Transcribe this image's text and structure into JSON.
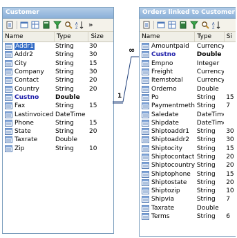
{
  "customer": {
    "title": "Customer",
    "columns": [
      "Name",
      "Type",
      "Size"
    ],
    "more_label": "»",
    "rows": [
      {
        "name": "Addr1",
        "type": "String",
        "size": "30",
        "selected": true
      },
      {
        "name": "Addr2",
        "type": "String",
        "size": "30"
      },
      {
        "name": "City",
        "type": "String",
        "size": "15"
      },
      {
        "name": "Company",
        "type": "String",
        "size": "30"
      },
      {
        "name": "Contact",
        "type": "String",
        "size": "20"
      },
      {
        "name": "Country",
        "type": "String",
        "size": "20"
      },
      {
        "name": "Custno",
        "type": "Double",
        "size": "",
        "key": true
      },
      {
        "name": "Fax",
        "type": "String",
        "size": "15"
      },
      {
        "name": "Lastinvoicedate",
        "type": "DateTime",
        "size": ""
      },
      {
        "name": "Phone",
        "type": "String",
        "size": "15"
      },
      {
        "name": "State",
        "type": "String",
        "size": "20"
      },
      {
        "name": "Taxrate",
        "type": "Double",
        "size": ""
      },
      {
        "name": "Zip",
        "type": "String",
        "size": "10"
      }
    ]
  },
  "orders": {
    "title": "Orders linked to Customer",
    "columns": [
      "Name",
      "Type",
      "Si"
    ],
    "rows": [
      {
        "name": "Amountpaid",
        "type": "Currency",
        "size": ""
      },
      {
        "name": "Custno",
        "type": "Double",
        "size": "",
        "key": true
      },
      {
        "name": "Empno",
        "type": "Integer",
        "size": ""
      },
      {
        "name": "Freight",
        "type": "Currency",
        "size": ""
      },
      {
        "name": "Itemstotal",
        "type": "Currency",
        "size": ""
      },
      {
        "name": "Orderno",
        "type": "Double",
        "size": ""
      },
      {
        "name": "Po",
        "type": "String",
        "size": "15"
      },
      {
        "name": "Paymentmethod",
        "type": "String",
        "size": "7"
      },
      {
        "name": "Saledate",
        "type": "DateTime",
        "size": ""
      },
      {
        "name": "Shipdate",
        "type": "DateTime",
        "size": ""
      },
      {
        "name": "Shiptoaddr1",
        "type": "String",
        "size": "30"
      },
      {
        "name": "Shiptoaddr2",
        "type": "String",
        "size": "30"
      },
      {
        "name": "Shiptocity",
        "type": "String",
        "size": "15"
      },
      {
        "name": "Shiptocontact",
        "type": "String",
        "size": "20"
      },
      {
        "name": "Shiptocountry",
        "type": "String",
        "size": "20"
      },
      {
        "name": "Shiptophone",
        "type": "String",
        "size": "15"
      },
      {
        "name": "Shiptostate",
        "type": "String",
        "size": "20"
      },
      {
        "name": "Shiptozip",
        "type": "String",
        "size": "10"
      },
      {
        "name": "Shipvia",
        "type": "String",
        "size": "7"
      },
      {
        "name": "Taxrate",
        "type": "Double",
        "size": ""
      },
      {
        "name": "Terms",
        "type": "String",
        "size": "6"
      }
    ]
  },
  "relation": {
    "one_label": "1",
    "many_label": "∞"
  },
  "colors": {
    "title_gradient_top": "#b3cde8",
    "title_gradient_bottom": "#8bb0d8",
    "key_field": "#1a1aa8",
    "selection": "#316ac5",
    "link_line": "#1f3f7a"
  },
  "toolbar_icons": [
    "new-field-icon",
    "view-icon",
    "grid-icon",
    "calculator-icon",
    "filter-icon",
    "search-icon",
    "sort-icon"
  ]
}
